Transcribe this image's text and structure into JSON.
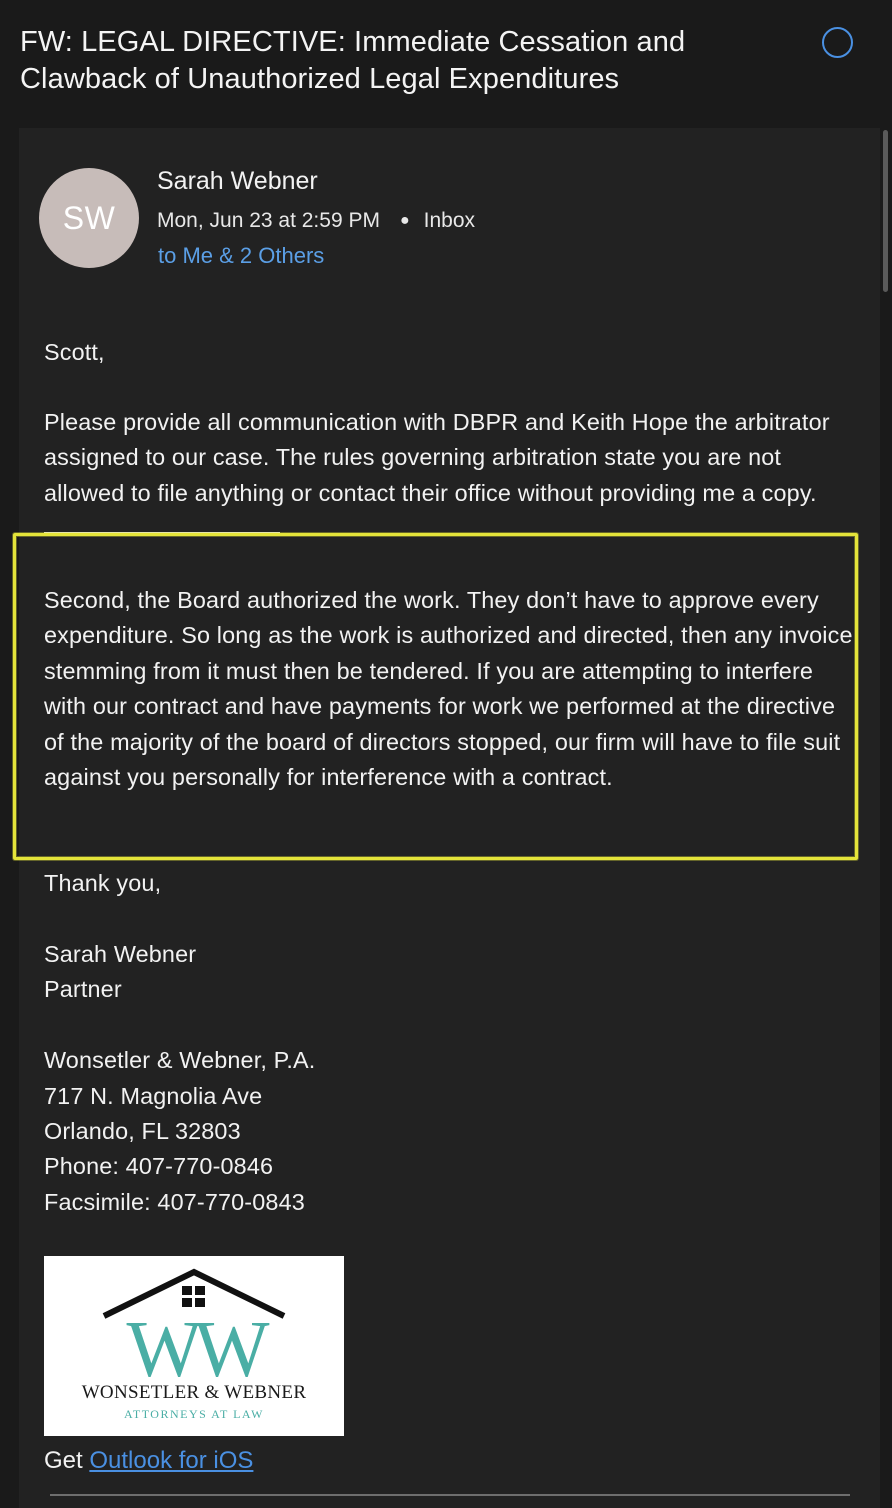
{
  "subject": "FW: LEGAL DIRECTIVE: Immediate Cessation and Clawback of Unauthorized Legal Expenditures",
  "sender": {
    "initials": "SW",
    "name": "Sarah Webner",
    "date": "Mon, Jun 23 at 2:59 PM",
    "folder": "Inbox",
    "recipients": "to Me & 2 Others"
  },
  "body": {
    "greeting": "Scott,",
    "paragraph1": "Please provide all communication with DBPR and Keith Hope the arbitrator assigned to our case. The rules governing arbitration state you are not allowed to file anything or contact their office without providing me a copy.",
    "paragraph2": "Second, the Board authorized the work. They don’t have to approve every expenditure. So long as the work is authorized and directed, then any invoice stemming from it must then be tendered. If you are attempting to interfere with our contract and have payments for work we performed at the directive of the majority of the board of directors stopped, our firm will have to file suit against you personally for interference with a contract.",
    "closing": "Thank you,"
  },
  "signature": {
    "name": "Sarah Webner",
    "title": "Partner",
    "firm": "Wonsetler & Webner, P.A.",
    "address1": "717 N. Magnolia Ave",
    "address2": "Orlando, FL 32803",
    "phone": "Phone: 407-770-0846",
    "fax": "Facsimile: 407-770-0843"
  },
  "logo": {
    "firm": "WONSETLER & WEBNER",
    "subtitle": "ATTORNEYS AT LAW",
    "monogram": "WW"
  },
  "footer": {
    "prefix": "Get ",
    "link": "Outlook for iOS"
  },
  "colors": {
    "background": "#1a1a1a",
    "card": "#222222",
    "accent_blue": "#4a90e2",
    "link_blue": "#5b9fe6",
    "highlight_yellow": "#e4e43a",
    "avatar": "#c7bcb9",
    "logo_teal": "#4aaea5"
  }
}
